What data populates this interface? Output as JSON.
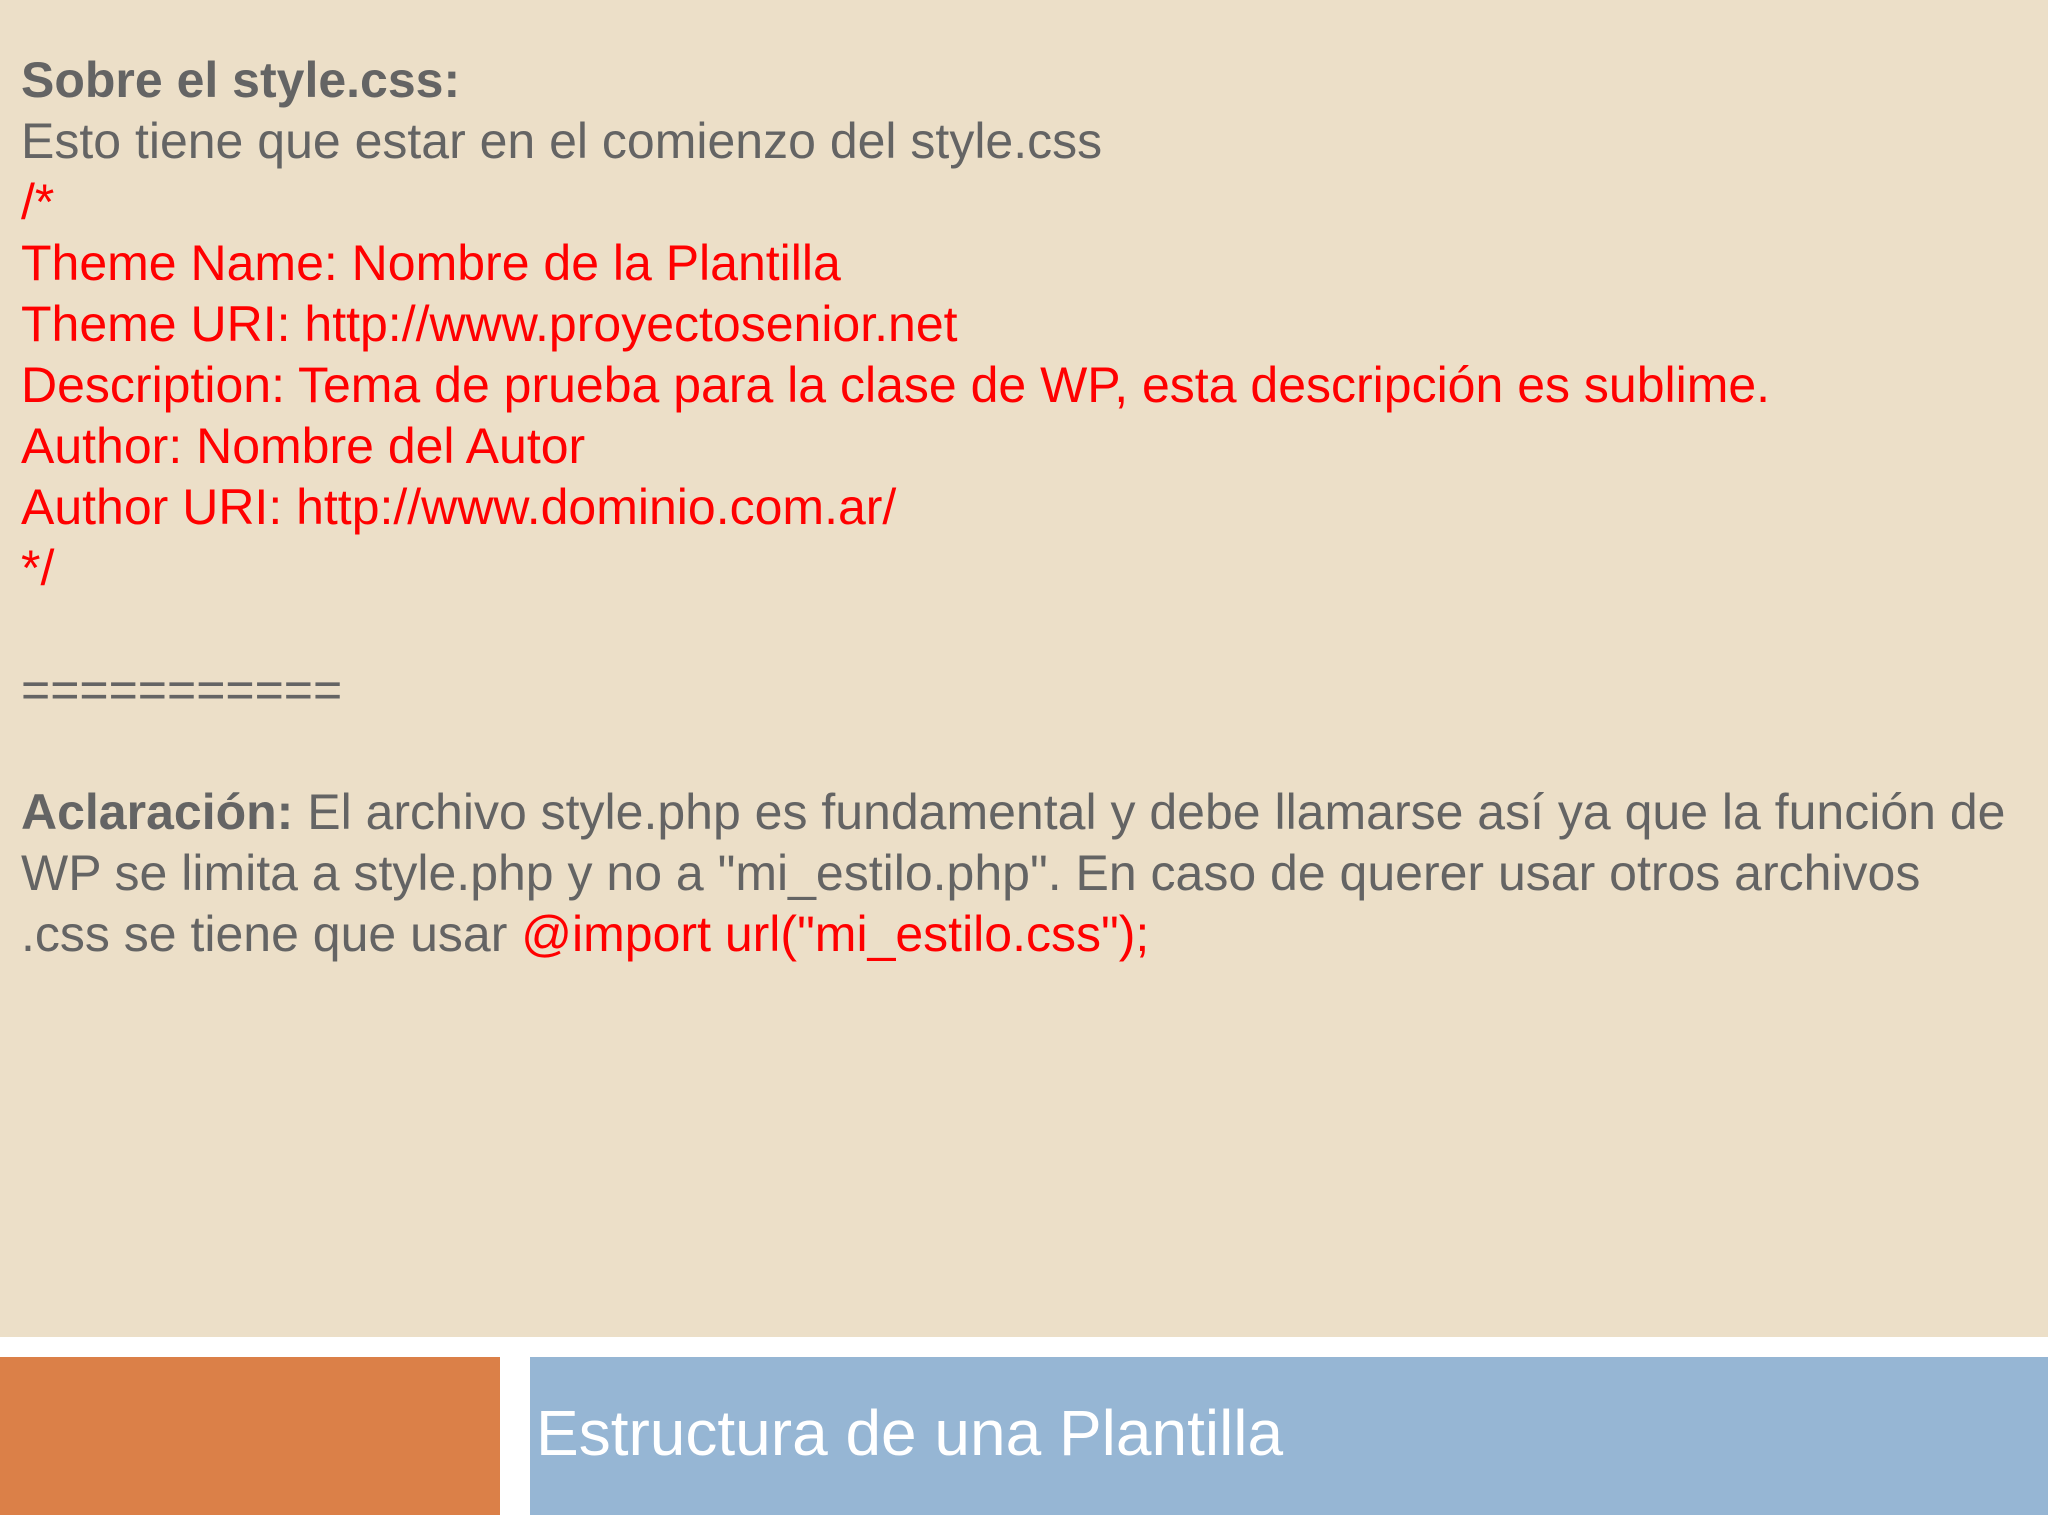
{
  "slide": {
    "heading": "Sobre el style.css:",
    "intro": "Esto tiene que estar en el comienzo del style.css",
    "code_lines": [
      "/*",
      "Theme Name: Nombre de la Plantilla",
      "Theme URI: http://www.proyectosenior.net",
      "Description: Tema de prueba para la clase de WP, esta descripción es sublime.",
      "Author: Nombre del Autor",
      "Author URI: http://www.dominio.com.ar/",
      "*/"
    ],
    "separator": "===========",
    "note_label": "Aclaración:",
    "note_text": " El archivo style.php es fundamental y debe llamarse así ya que la función de WP se limita a style.php y no a \"mi_estilo.php\". En caso de querer usar otros archivos .css se tiene que usar ",
    "note_code": "@import url(\"mi_estilo.css\");",
    "footer_title": "Estructura de una Plantilla"
  },
  "colors": {
    "background": "#ecdfc8",
    "text_gray": "#646464",
    "code_red": "#ff0000",
    "footer_orange": "#db8048",
    "footer_blue": "#96b6d4"
  }
}
